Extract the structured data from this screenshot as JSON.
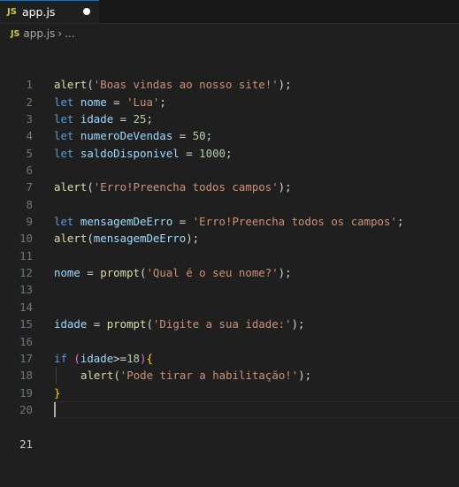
{
  "tab": {
    "badge": "JS",
    "filename": "app.js"
  },
  "breadcrumbs": {
    "badge": "JS",
    "file": "app.js",
    "separator": "›",
    "more": "..."
  },
  "editor": {
    "line_numbers": [
      "1",
      "2",
      "3",
      "4",
      "5",
      "6",
      "7",
      "8",
      "9",
      "10",
      "11",
      "12",
      "13",
      "14",
      "15",
      "16",
      "17",
      "18",
      "19",
      "20",
      "21"
    ],
    "lines": {
      "l2": {
        "fn": "alert",
        "p1": "(",
        "s": "'Boas vindas ao nosso site!'",
        "p2": ");"
      },
      "l3": {
        "kw": "let",
        "v": "nome",
        "eq": " = ",
        "s": "'Lua'",
        "end": ";"
      },
      "l4": {
        "kw": "let",
        "v": "idade",
        "eq": " = ",
        "n": "25",
        "end": ";"
      },
      "l5": {
        "kw": "let",
        "v": "numeroDeVendas",
        "eq": " = ",
        "n": "50",
        "end": ";"
      },
      "l6": {
        "kw": "let",
        "v": "saldoDisponivel",
        "eq": " = ",
        "n": "1000",
        "end": ";"
      },
      "l8": {
        "fn": "alert",
        "p1": "(",
        "s": "'Erro!Preencha todos campos'",
        "p2": ");"
      },
      "l10": {
        "kw": "let",
        "v": "mensagemDeErro",
        "eq": " = ",
        "s": "'Erro!Preencha todos os campos'",
        "end": ";"
      },
      "l11": {
        "fn": "alert",
        "p1": "(",
        "v": "mensagemDeErro",
        "p2": ");"
      },
      "l13": {
        "v": "nome",
        "eq": " = ",
        "fn": "prompt",
        "p1": "(",
        "s": "'Qual é o seu nome?'",
        "p2": ");"
      },
      "l16": {
        "v": "idade",
        "eq": " = ",
        "fn": "prompt",
        "p1": "(",
        "s": "'Digite a sua idade:'",
        "p2": ");"
      },
      "l18": {
        "kw": "if",
        "sp": " ",
        "p1": "(",
        "v": "idade",
        "op": ">=",
        "n": "18",
        "p2": ")",
        "b": "{"
      },
      "l19": {
        "fn": "alert",
        "p1": "(",
        "s": "'Pode tirar a habilitação!'",
        "p2": ");"
      },
      "l20": {
        "b": "}"
      }
    }
  },
  "colors": {
    "background": "#1f1f1f",
    "keyword": "#569cd6",
    "function": "#dcdcaa",
    "variable": "#9cdcfe",
    "string": "#ce9178",
    "number": "#b5cea8",
    "bracket": "#ffd700",
    "tab_accent": "#0078d4"
  }
}
